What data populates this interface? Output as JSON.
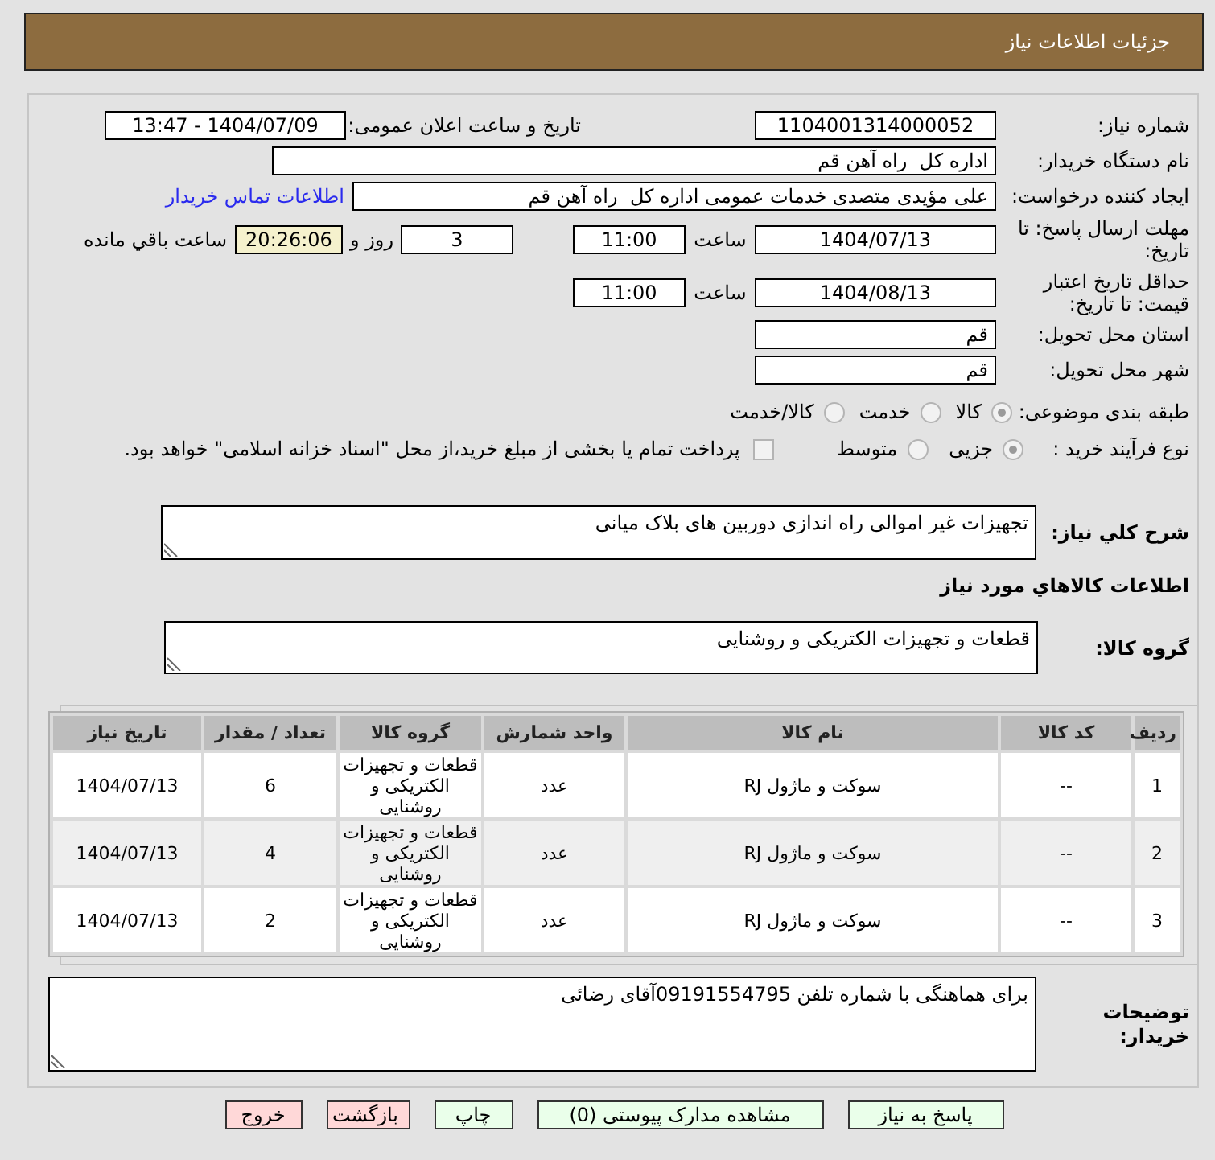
{
  "header": {
    "title": "جزئیات اطلاعات نیاز"
  },
  "need_number": {
    "label": "شماره نیاز:",
    "value": "1104001314000052"
  },
  "announcement": {
    "label": "تاریخ و ساعت اعلان عمومی:",
    "value": "1404/07/09 - 13:47"
  },
  "buyer_org": {
    "label": "نام دستگاه خریدار:",
    "value": "اداره کل  راه آهن قم"
  },
  "requester": {
    "label": "ایجاد کننده درخواست:",
    "value": "علی مؤیدی متصدی خدمات عمومی اداره کل  راه آهن قم",
    "link": "اطلاعات تماس خریدار"
  },
  "reply_deadline": {
    "label": "مهلت ارسال پاسخ: تا تاریخ:",
    "date": "1404/07/13",
    "time_label": "ساعت",
    "time": "11:00",
    "days": "3",
    "days_label": "روز و",
    "remaining": "20:26:06",
    "remaining_label": "ساعت باقي مانده"
  },
  "price_validity": {
    "label": "حداقل تاریخ اعتبار قیمت: تا تاریخ:",
    "date": "1404/08/13",
    "time_label": "ساعت",
    "time": "11:00"
  },
  "delivery_province": {
    "label": "استان محل تحویل:",
    "value": "قم"
  },
  "delivery_city": {
    "label": "شهر محل تحویل:",
    "value": "قم"
  },
  "subject_category": {
    "label": "طبقه بندی موضوعی:",
    "options": [
      {
        "label": "کالا",
        "selected": true
      },
      {
        "label": "خدمت",
        "selected": false
      },
      {
        "label": "کالا/خدمت",
        "selected": false
      }
    ]
  },
  "purchase_process": {
    "label": "نوع فرآیند خرید :",
    "options": [
      {
        "label": "جزیی",
        "selected": true
      },
      {
        "label": "متوسط",
        "selected": false
      }
    ],
    "treasury_payment": {
      "label": "پرداخت تمام یا بخشی از مبلغ خرید،از محل \"اسناد خزانه اسلامی\" خواهد بود.",
      "checked": false
    }
  },
  "description": {
    "label": "شرح کلي نياز:",
    "value": "تجهیزات غیر اموالی راه اندازی دوربین های بلاک میانی"
  },
  "goods_heading": "اطلاعات کالاهاي مورد نياز",
  "goods_group": {
    "label": "گروه کالا:",
    "value": "قطعات و تجهیزات الکتریکی و روشنایی"
  },
  "table": {
    "columns": [
      "ردیف",
      "کد کالا",
      "نام کالا",
      "واحد شمارش",
      "گروه کالا",
      "تعداد / مقدار",
      "تاریخ نیاز"
    ],
    "rows": [
      {
        "cells": [
          "1",
          "--",
          "سوکت و ماژول RJ",
          "عدد",
          "قطعات و تجهیزات الکتریکی و روشنایی",
          "6",
          "1404/07/13"
        ]
      },
      {
        "cells": [
          "2",
          "--",
          "سوکت و ماژول RJ",
          "عدد",
          "قطعات و تجهیزات الکتریکی و روشنایی",
          "4",
          "1404/07/13"
        ]
      },
      {
        "cells": [
          "3",
          "--",
          "سوکت و ماژول RJ",
          "عدد",
          "قطعات و تجهیزات الکتریکی و روشنایی",
          "2",
          "1404/07/13"
        ]
      }
    ]
  },
  "buyer_notes": {
    "label": "توضیحات خریدار:",
    "value": "برای هماهنگی با شماره تلفن 09191554795آقای رضائی"
  },
  "buttons": [
    {
      "label": "پاسخ به نیاز",
      "kind": "action"
    },
    {
      "label": "مشاهده مدارک پیوستی (0)",
      "kind": "action"
    },
    {
      "label": "چاپ",
      "kind": "action"
    },
    {
      "label": "بازگشت",
      "kind": "leave"
    },
    {
      "label": "خروج",
      "kind": "leave"
    }
  ]
}
